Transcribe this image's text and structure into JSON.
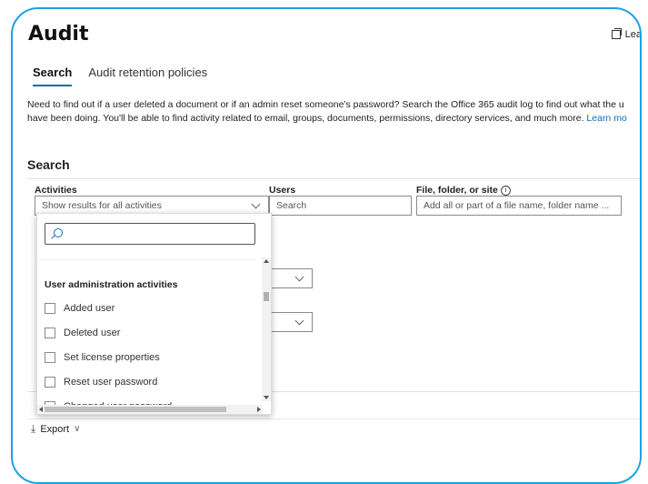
{
  "page": {
    "title": "Audit",
    "learn_more_top": "Lea"
  },
  "tabs": [
    {
      "label": "Search",
      "active": true
    },
    {
      "label": "Audit retention policies",
      "active": false
    }
  ],
  "description": {
    "line1": "Need to find out if a user deleted a document or if an admin reset someone's password? Search the Office 365 audit log to find out what the u",
    "line2": "have been doing. You'll be able to find activity related to email, groups, documents, permissions, directory services, and much more.",
    "link": "Learn mo"
  },
  "search": {
    "title": "Search",
    "activities": {
      "label": "Activities",
      "value": "Show results for all activities"
    },
    "users": {
      "label": "Users",
      "placeholder": "Search"
    },
    "file": {
      "label": "File, folder, or site",
      "placeholder": "Add all or part of a file name, folder name ..."
    }
  },
  "dropdown": {
    "group": "User administration activities",
    "items": [
      "Added user",
      "Deleted user",
      "Set license properties",
      "Reset user password",
      "Changed user password"
    ]
  },
  "toolbar": {
    "export_label": "Export"
  },
  "colors": {
    "accent": "#0f6cbd",
    "frame": "#1aa3e0"
  }
}
